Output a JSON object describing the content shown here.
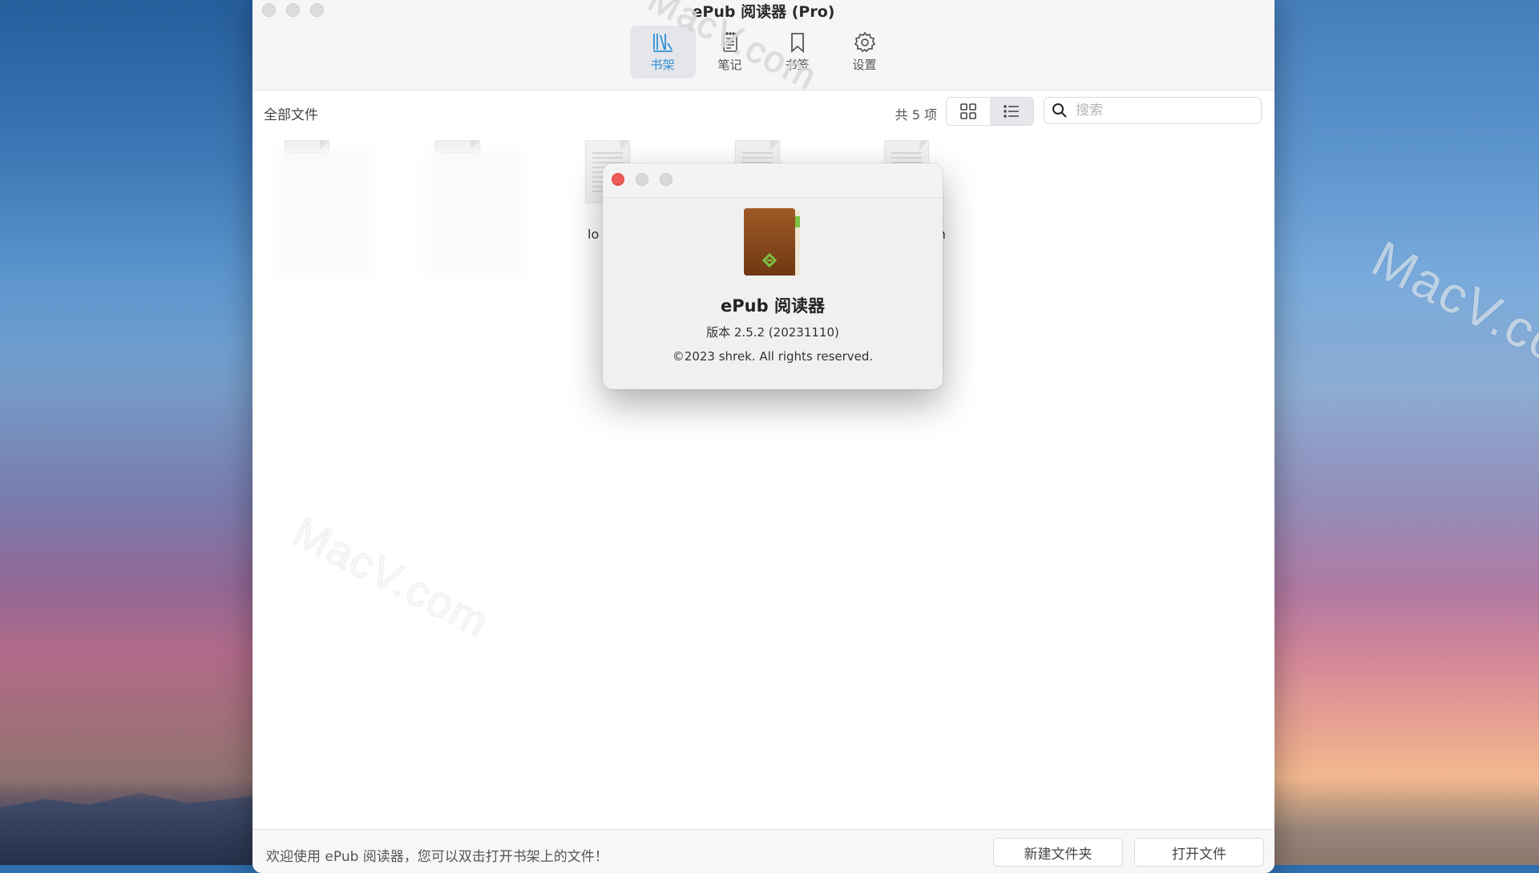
{
  "window": {
    "title": "ePub 阅读器 (Pro)"
  },
  "toolbar": {
    "items": [
      {
        "label": "书架",
        "icon": "bookshelf-icon",
        "active": true
      },
      {
        "label": "笔记",
        "icon": "notes-icon",
        "active": false
      },
      {
        "label": "书签",
        "icon": "bookmark-icon",
        "active": false
      },
      {
        "label": "设置",
        "icon": "gear-icon",
        "active": false
      }
    ]
  },
  "subbar": {
    "breadcrumb": "全部文件",
    "count": "共 5 项",
    "search_placeholder": "搜索"
  },
  "files": [
    {
      "name": ""
    },
    {
      "name": ""
    },
    {
      "name": "lo"
    },
    {
      "name": ""
    },
    {
      "name": "tin"
    }
  ],
  "about": {
    "app_name": "ePub 阅读器",
    "version": "版本 2.5.2 (20231110)",
    "copyright": "©2023 shrek. All rights reserved."
  },
  "footer": {
    "welcome": "欢迎使用 ePub 阅读器，您可以双击打开书架上的文件！",
    "new_folder_label": "新建文件夹",
    "open_file_label": "打开文件"
  },
  "watermarks": [
    "MacV.com",
    "MacV.com",
    "MacV.co"
  ],
  "colors": {
    "accent": "#2f8fd8",
    "close_red": "#ed5a55",
    "book_brown": "#8a4b1c",
    "book_green": "#7dc242"
  }
}
